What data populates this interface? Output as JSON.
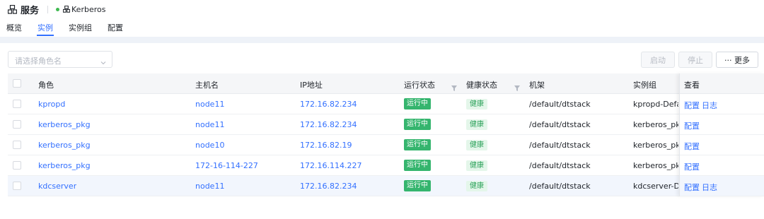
{
  "header": {
    "title": "服务",
    "service_name": "Kerberos",
    "status_color": "#3fb950"
  },
  "tabs": [
    {
      "label": "概览",
      "active": false
    },
    {
      "label": "实例",
      "active": true
    },
    {
      "label": "实例组",
      "active": false
    },
    {
      "label": "配置",
      "active": false
    }
  ],
  "filter": {
    "placeholder": "请选择角色名"
  },
  "actions": {
    "start": "启动",
    "stop": "停止",
    "more": "··· 更多"
  },
  "table": {
    "columns": [
      "角色",
      "主机名",
      "IP地址",
      "运行状态",
      "健康状态",
      "机架",
      "实例组",
      "查看"
    ],
    "rows": [
      {
        "role": "kpropd",
        "host": "node11",
        "ip": "172.16.82.234",
        "run": "运行中",
        "health": "健康",
        "rack": "/default/dtstack",
        "group": "kpropd-Defau",
        "ops": [
          "配置",
          "日志"
        ]
      },
      {
        "role": "kerberos_pkg",
        "host": "node11",
        "ip": "172.16.82.234",
        "run": "运行中",
        "health": "健康",
        "rack": "/default/dtstack",
        "group": "kerberos_pkg",
        "ops": [
          "配置"
        ]
      },
      {
        "role": "kerberos_pkg",
        "host": "node10",
        "ip": "172.16.82.19",
        "run": "运行中",
        "health": "健康",
        "rack": "/default/dtstack",
        "group": "kerberos_pkg",
        "ops": [
          "配置"
        ]
      },
      {
        "role": "kerberos_pkg",
        "host": "172-16-114-227",
        "ip": "172.16.114.227",
        "run": "运行中",
        "health": "健康",
        "rack": "/default/dtstack",
        "group": "kerberos_pkg",
        "ops": [
          "配置"
        ]
      },
      {
        "role": "kdcserver",
        "host": "node11",
        "ip": "172.16.82.234",
        "run": "运行中",
        "health": "健康",
        "rack": "/default/dtstack",
        "group": "kdcserver-Def",
        "ops": [
          "配置",
          "日志"
        ]
      }
    ]
  },
  "colors": {
    "accent": "#3370ff",
    "running": "#35b56e",
    "healthy_bg": "#e4f6ea",
    "healthy_text": "#2ea35c"
  }
}
